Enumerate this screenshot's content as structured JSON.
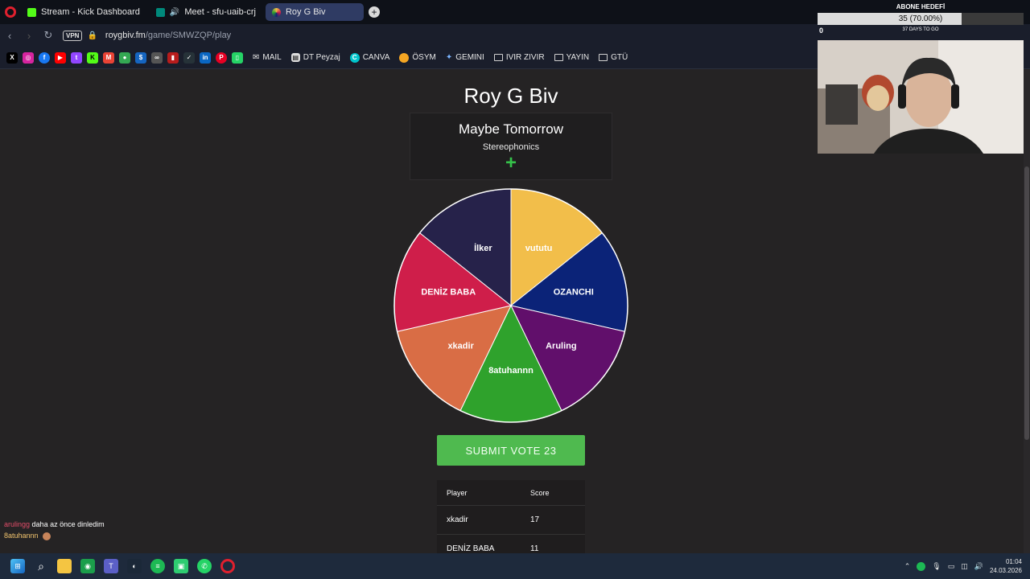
{
  "browser": {
    "tabs": [
      {
        "label": "Stream - Kick Dashboard",
        "color": "#53fc18"
      },
      {
        "label": "Meet - sfu-uaib-crj",
        "color": "#00897b"
      },
      {
        "label": "Roy G Biv",
        "color": "#e8a33c"
      }
    ],
    "new_tab": "+",
    "vpn_label": "VPN",
    "url_host": "roygbiv.fm",
    "url_path": "/game/SMWZQP/play",
    "bookmarks": [
      {
        "label": "MAIL",
        "icon": "mail-icon"
      },
      {
        "label": "DT Peyzaj",
        "icon": "page-icon"
      },
      {
        "label": "CANVA",
        "icon": "canva-icon"
      },
      {
        "label": "ÖSYM",
        "icon": "osym-icon"
      },
      {
        "label": "GEMINI",
        "icon": "gemini-icon"
      },
      {
        "label": "IVIR ZIVIR",
        "icon": "folder-icon"
      },
      {
        "label": "YAYIN",
        "icon": "folder-icon"
      },
      {
        "label": "GTÜ",
        "icon": "folder-icon"
      }
    ]
  },
  "game": {
    "title": "Roy G Biv",
    "song_title": "Maybe Tomorrow",
    "song_artist": "Stereophonics",
    "add_symbol": "+",
    "submit_label": "SUBMIT VOTE 23",
    "wheel": [
      {
        "name": "vututu",
        "color": "#f2be4a"
      },
      {
        "name": "OZANCHI",
        "color": "#0b2378"
      },
      {
        "name": "Aruling",
        "color": "#610f6b"
      },
      {
        "name": "8atuhannn",
        "color": "#2fa22c"
      },
      {
        "name": "xkadir",
        "color": "#d96d45"
      },
      {
        "name": "DENİZ BABA",
        "color": "#cf1e4a"
      },
      {
        "name": "İlker",
        "color": "#26224a"
      }
    ],
    "scoreboard": {
      "headers": [
        "Player",
        "Score"
      ],
      "rows": [
        {
          "player": "xkadir",
          "score": "17"
        },
        {
          "player": "DENİZ BABA",
          "score": "11"
        }
      ]
    }
  },
  "overlay": {
    "goal_title": "ABONE HEDEFİ",
    "goal_text": "35 (70.00%)",
    "goal_progress": 0.7,
    "goal_sub": "37 DAYS TO GO",
    "goal_start": "0",
    "goal_end": "50"
  },
  "chat": [
    {
      "user": "arulingg",
      "message": "daha az önce dinledim"
    },
    {
      "user": "8atuhannn",
      "message": ""
    }
  ],
  "system": {
    "time": "01:04",
    "date": "24.03.2026"
  }
}
